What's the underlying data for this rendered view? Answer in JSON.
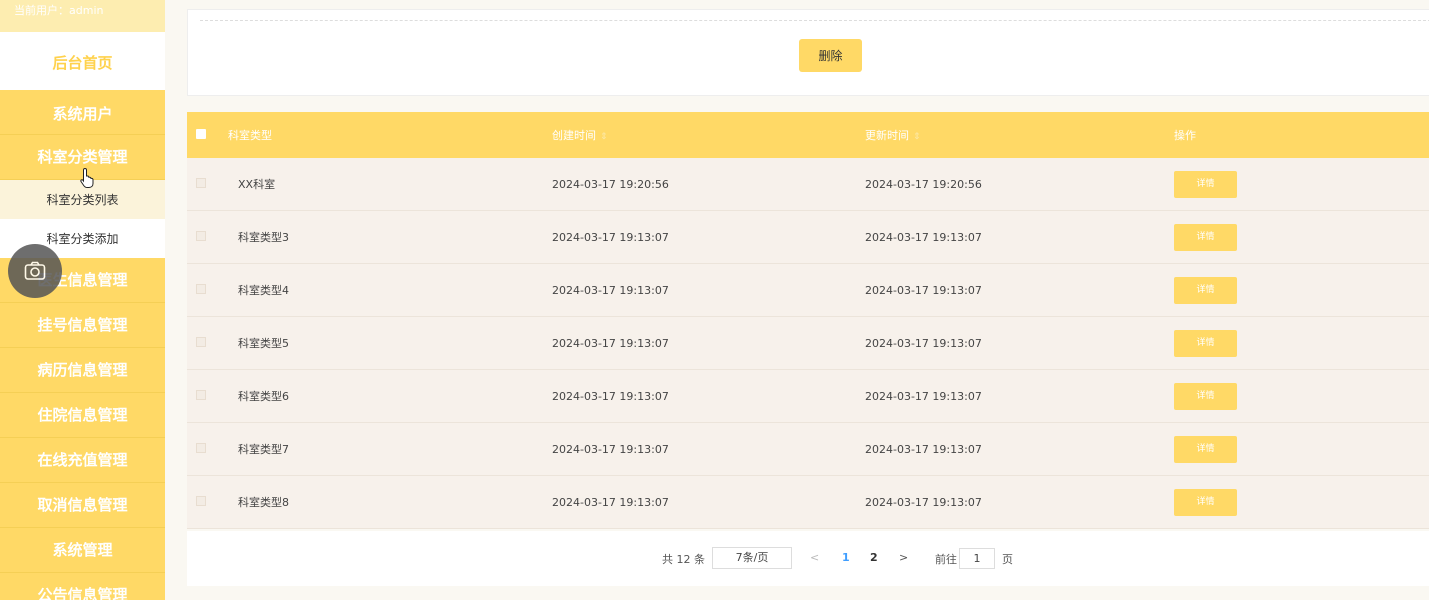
{
  "sidebar": {
    "user_label": "当前用户：admin",
    "home": "后台首页",
    "menu": [
      "系统用户",
      "科室分类管理"
    ],
    "sub_items": [
      "科室分类列表",
      "科室分类添加"
    ],
    "menu_rest": [
      "医生信息管理",
      "挂号信息管理",
      "病历信息管理",
      "住院信息管理",
      "在线充值管理",
      "取消信息管理",
      "系统管理",
      "公告信息管理"
    ]
  },
  "toolbar": {
    "delete_label": "删除"
  },
  "table": {
    "headers": {
      "type": "科室类型",
      "created": "创建时间",
      "updated": "更新时间",
      "op": "操作"
    },
    "sort_icon": "⇕",
    "detail_label": "详情",
    "rows": [
      {
        "type": "XX科室",
        "created": "2024-03-17 19:20:56",
        "updated": "2024-03-17 19:20:56"
      },
      {
        "type": "科室类型3",
        "created": "2024-03-17 19:13:07",
        "updated": "2024-03-17 19:13:07"
      },
      {
        "type": "科室类型4",
        "created": "2024-03-17 19:13:07",
        "updated": "2024-03-17 19:13:07"
      },
      {
        "type": "科室类型5",
        "created": "2024-03-17 19:13:07",
        "updated": "2024-03-17 19:13:07"
      },
      {
        "type": "科室类型6",
        "created": "2024-03-17 19:13:07",
        "updated": "2024-03-17 19:13:07"
      },
      {
        "type": "科室类型7",
        "created": "2024-03-17 19:13:07",
        "updated": "2024-03-17 19:13:07"
      },
      {
        "type": "科室类型8",
        "created": "2024-03-17 19:13:07",
        "updated": "2024-03-17 19:13:07"
      }
    ]
  },
  "pagination": {
    "total": "共 12 条",
    "page_size": "7条/页",
    "prev": "<",
    "page1": "1",
    "page2": "2",
    "next": ">",
    "goto_label": "前往",
    "goto_value": "1",
    "page_suffix": "页"
  }
}
